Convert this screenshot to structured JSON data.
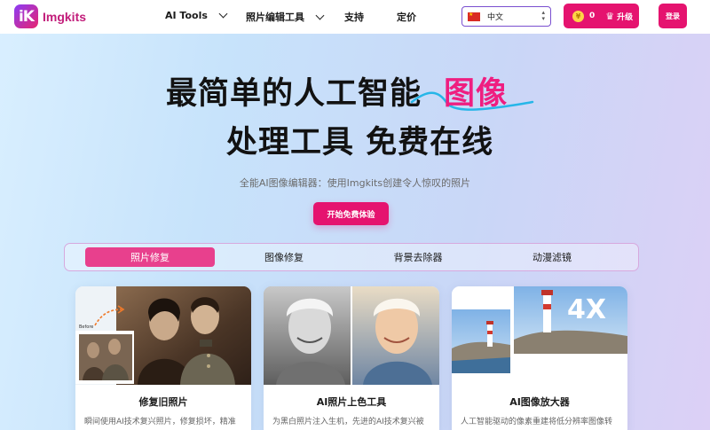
{
  "brand": {
    "logo_mark": "iK",
    "name": "Imgkits"
  },
  "nav": {
    "menu": [
      {
        "label": "AI Tools",
        "dropdown": true
      },
      {
        "label": "照片编辑工具",
        "dropdown": true
      },
      {
        "label": "支持",
        "dropdown": false
      },
      {
        "label": "定价",
        "dropdown": false
      }
    ],
    "language": {
      "selected": "中文",
      "flag_icon": "china-flag-icon"
    },
    "credits": {
      "count": "0",
      "upgrade_label": "升级"
    },
    "login_label": "登录"
  },
  "hero": {
    "line1": "最简单的人工智能",
    "line1_highlight": "图像",
    "line2": "处理工具 免费在线",
    "subtitle": "全能AI图像编辑器：使用Imgkits创建令人惊叹的照片",
    "cta_label": "开始免费体验"
  },
  "tabs": [
    {
      "label": "照片修复",
      "active": true
    },
    {
      "label": "图像修复",
      "active": false
    },
    {
      "label": "背景去除器",
      "active": false
    },
    {
      "label": "动漫滤镜",
      "active": false
    }
  ],
  "cards": [
    {
      "title": "修复旧照片",
      "desc": "瞬间使用AI技术复兴照片，修复损坏，精准",
      "image_badge": "Before"
    },
    {
      "title": "AI照片上色工具",
      "desc": "为黑白照片注入生机，先进的AI技术复兴被"
    },
    {
      "title": "AI图像放大器",
      "desc": "人工智能驱动的像素重建将低分辨率图像转",
      "image_badge": "4X"
    }
  ],
  "colors": {
    "accent": "#e5136f",
    "tab_active": "#e8408d",
    "highlight_text": "#ef1e80"
  }
}
